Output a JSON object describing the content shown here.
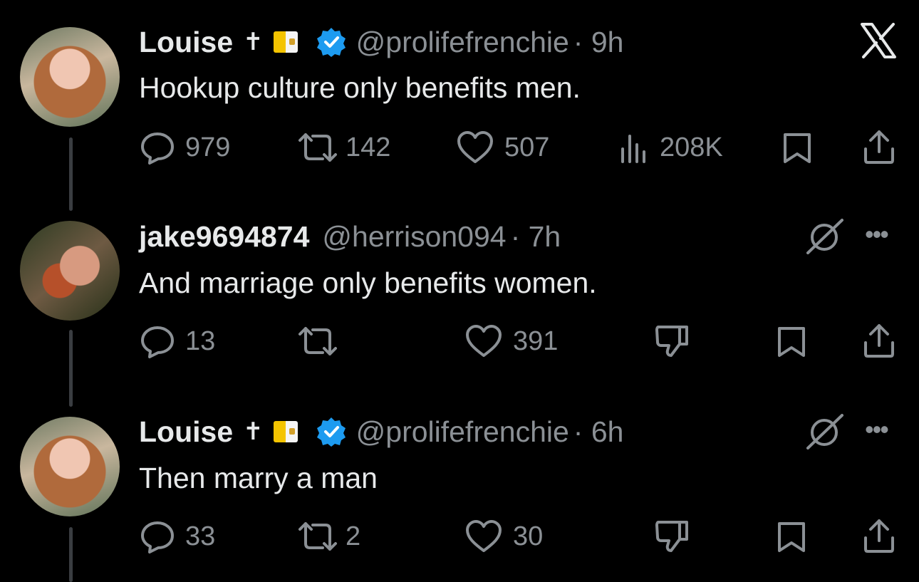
{
  "app": {
    "logo_icon": "x-logo-icon"
  },
  "tweets": [
    {
      "name": "Louise",
      "name_emoji": "✝",
      "flag_icon": "vatican-flag-icon",
      "verified": true,
      "handle": "@prolifefrenchie",
      "time": "· 9h",
      "text": "Hookup culture only benefits men.",
      "stats": {
        "replies": "979",
        "retweets": "142",
        "likes": "507",
        "views": "208K"
      }
    },
    {
      "name": "jake9694874",
      "verified": false,
      "handle": "@herrison094",
      "time": "· 7h",
      "text": "And marriage only benefits women.",
      "stats": {
        "replies": "13",
        "retweets": "",
        "likes": "391"
      },
      "more_icon": "more-options-icon"
    },
    {
      "name": "Louise",
      "name_emoji": "✝",
      "flag_icon": "vatican-flag-icon",
      "verified": true,
      "handle": "@prolifefrenchie",
      "time": "· 6h",
      "text": "Then marry a man",
      "stats": {
        "replies": "33",
        "retweets": "2",
        "likes": "30"
      },
      "more_icon": "more-options-icon"
    }
  ],
  "colors": {
    "background": "#000000",
    "text": "#e7e9ea",
    "muted": "#8b9095",
    "verified": "#1d9bf0",
    "thread_line": "#3a3d41"
  }
}
